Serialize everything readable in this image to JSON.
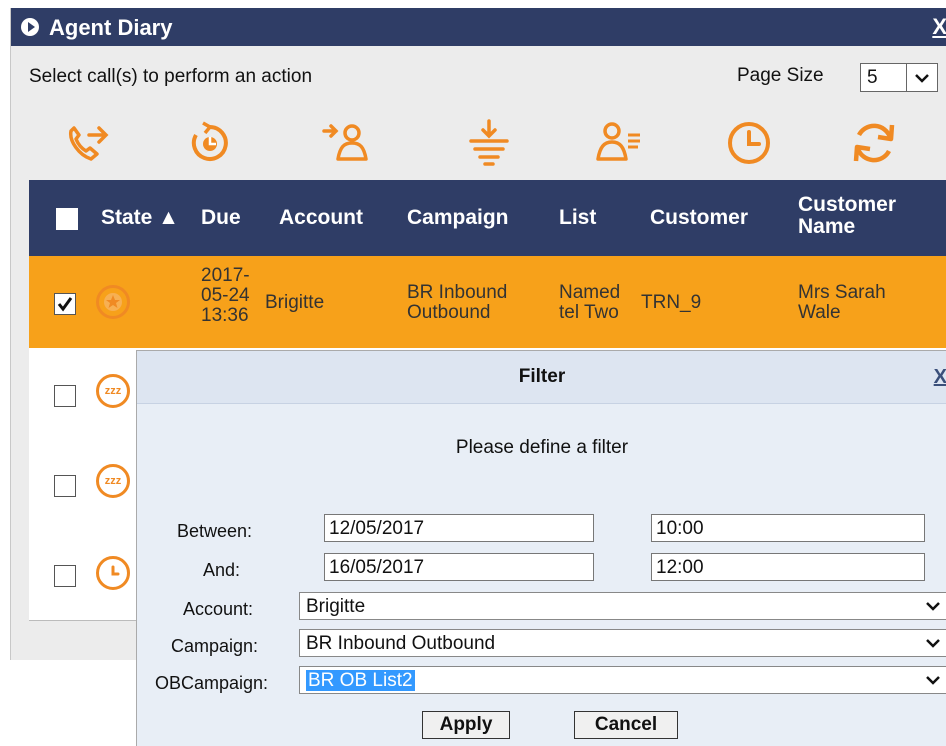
{
  "diary": {
    "title": "Agent Diary",
    "close": "X",
    "instruction": "Select call(s) to perform an action",
    "page_size_label": "Page Size",
    "page_size_value": "5",
    "toolbar": [
      "call-back-icon",
      "callback-timer-icon",
      "transfer-agent-icon",
      "filter-icon",
      "agent-list-icon",
      "clock-icon",
      "refresh-icon"
    ],
    "accent_color": "#f08a23",
    "header_color": "#2f3d66",
    "selected_row_color": "#f7a11a"
  },
  "table": {
    "columns": [
      "State ▲",
      "Due",
      "Account",
      "Campaign",
      "List",
      "Customer",
      "Customer",
      "Name"
    ],
    "row1": {
      "due_1": "2017-",
      "due_2": "05-24",
      "due_3": "13:36",
      "account": "Brigitte",
      "campaign_1": "BR Inbound",
      "campaign_2": "Outbound",
      "list_1": "Named",
      "list_2": "tel Two",
      "customer": "TRN_9",
      "name_1": "Mrs Sarah",
      "name_2": "Wale",
      "state_icon": "star-icon"
    },
    "row2": {
      "state_icon": "snooze-icon",
      "icon_text": "zzz"
    },
    "row3": {
      "state_icon": "snooze-icon",
      "icon_text": "zzz"
    },
    "row4": {
      "state_icon": "clock-icon"
    }
  },
  "filter": {
    "title": "Filter",
    "close": "X",
    "prompt": "Please define a filter",
    "between_label": "Between:",
    "between_date": "12/05/2017",
    "between_time": "10:00",
    "and_label": "And:",
    "and_date": "16/05/2017",
    "and_time": "12:00",
    "account_label": "Account:",
    "account_value": "Brigitte",
    "campaign_label": "Campaign:",
    "campaign_value": "BR Inbound Outbound",
    "obcampaign_label": "OBCampaign:",
    "obcampaign_value": "BR OB List2",
    "apply": "Apply",
    "cancel": "Cancel"
  }
}
